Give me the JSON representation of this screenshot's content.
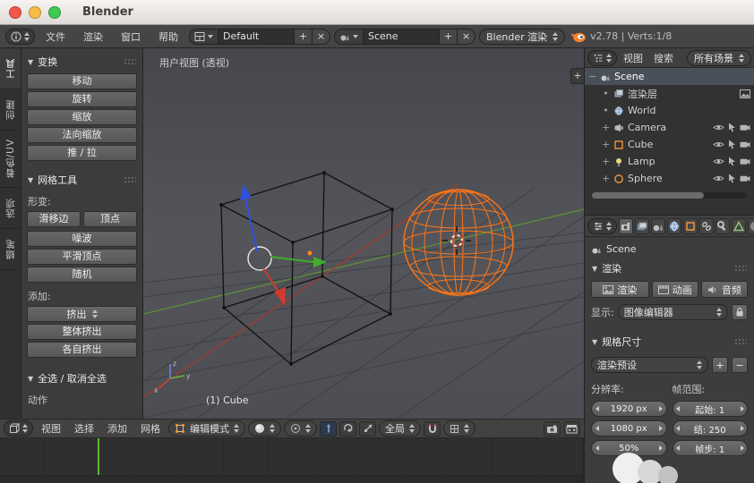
{
  "window": {
    "title": "Blender"
  },
  "colors": {
    "selection_orange": "#ff7517",
    "axis_x_red": "#a33b31",
    "axis_y_green": "#5d8f36",
    "axis_z_blue": "#3050e0",
    "playhead_green": "#5cb82e"
  },
  "icons": {
    "collapse": "▼",
    "plus": "+",
    "minus": "−",
    "close": "×"
  },
  "topbar": {
    "menus": [
      "文件",
      "渲染",
      "窗口",
      "帮助"
    ],
    "layout_value": "Default",
    "scene_value": "Scene",
    "engine_value": "Blender 渲染",
    "stats": "v2.78 | Verts:1/8"
  },
  "tool_tabs": [
    "工具",
    "创建",
    "着色/UV",
    "选项",
    "蜡笔"
  ],
  "toolshelf": {
    "transform": {
      "title": "变换",
      "buttons": [
        "移动",
        "旋转",
        "缩放",
        "法向缩放",
        "推 / 拉"
      ]
    },
    "mesh": {
      "title": "网格工具",
      "deform_label": "形变:",
      "slide_edge": "滑移边",
      "slide_vertex": "顶点",
      "noise": "噪波",
      "smooth": "平滑顶点",
      "randomize": "随机",
      "add_label": "添加:",
      "extrude": "挤出",
      "extrude_whole": "整体挤出",
      "extrude_individual": "各自挤出"
    },
    "select": {
      "title": "全选 / 取消全选",
      "action_label": "动作"
    }
  },
  "viewport": {
    "view_label": "用户视图 (透视)",
    "object_label": "(1) Cube",
    "header": {
      "menus": [
        "视图",
        "选择",
        "添加",
        "网格"
      ],
      "mode_value": "编辑模式",
      "orientation_value": "全局"
    }
  },
  "outliner": {
    "menus": [
      "视图",
      "搜索"
    ],
    "filter_value": "所有场景",
    "rows": [
      {
        "label": "Scene",
        "expander": "−"
      },
      {
        "label": "渲染层",
        "expander": "•"
      },
      {
        "label": "World",
        "expander": "•"
      },
      {
        "label": "Camera",
        "expander": "+"
      },
      {
        "label": "Cube",
        "expander": "+"
      },
      {
        "label": "Lamp",
        "expander": "+"
      },
      {
        "label": "Sphere",
        "expander": "+"
      }
    ]
  },
  "properties": {
    "breadcrumb": "Scene",
    "render": {
      "title": "渲染",
      "render_button": "渲染",
      "animation_button": "动画",
      "audio_button": "音频",
      "display_label": "显示:",
      "display_value": "图像编辑器"
    },
    "dimensions": {
      "title": "规格尺寸",
      "preset_value": "渲染预设",
      "resolution_label": "分辨率:",
      "frame_range_label": "帧范围:",
      "res_x": "1920 px",
      "res_y": "1080 px",
      "res_percent": "50%",
      "frame_start": "起始: 1",
      "frame_end": "结: 250",
      "frame_step": "帧步: 1"
    }
  }
}
